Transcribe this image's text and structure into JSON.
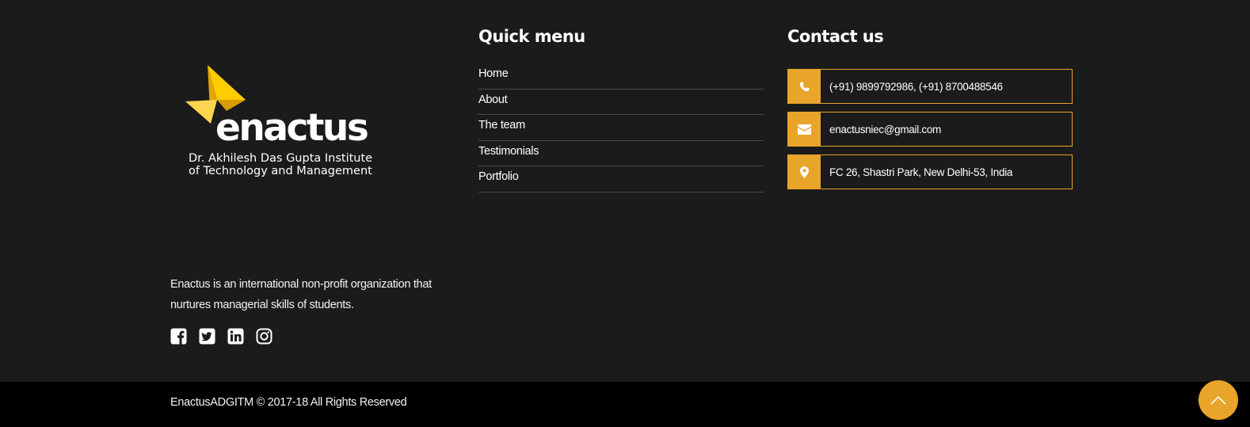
{
  "brand": {
    "logo_word": "enactus",
    "logo_tm": "™",
    "logo_sub_line1": "Dr. Akhilesh Das Gupta Institute",
    "logo_sub_line2": "of Technology and Management",
    "logo_color": "#ffcc00"
  },
  "about": {
    "text": "Enactus is an international non-profit organization that nurtures managerial skills of students."
  },
  "socials": [
    {
      "icon": "facebook-icon"
    },
    {
      "icon": "twitter-icon"
    },
    {
      "icon": "linkedin-icon"
    },
    {
      "icon": "instagram-icon"
    }
  ],
  "quick_menu": {
    "heading": "Quick menu",
    "items": [
      "Home",
      "About",
      "The team",
      "Testimonials",
      "Portfolio"
    ]
  },
  "contact": {
    "heading": "Contact us",
    "phone": "(+91) 9899792986, (+91) 8700488546",
    "email": "enactusniec@gmail.com",
    "address": "FC 26, Shastri Park, New Delhi-53, India",
    "accent": "#e8a52a"
  },
  "footer": {
    "copyright": "EnactusADGITM © 2017-18 All Rights Reserved"
  },
  "back_to_top": {
    "icon": "chevron-up-icon"
  }
}
